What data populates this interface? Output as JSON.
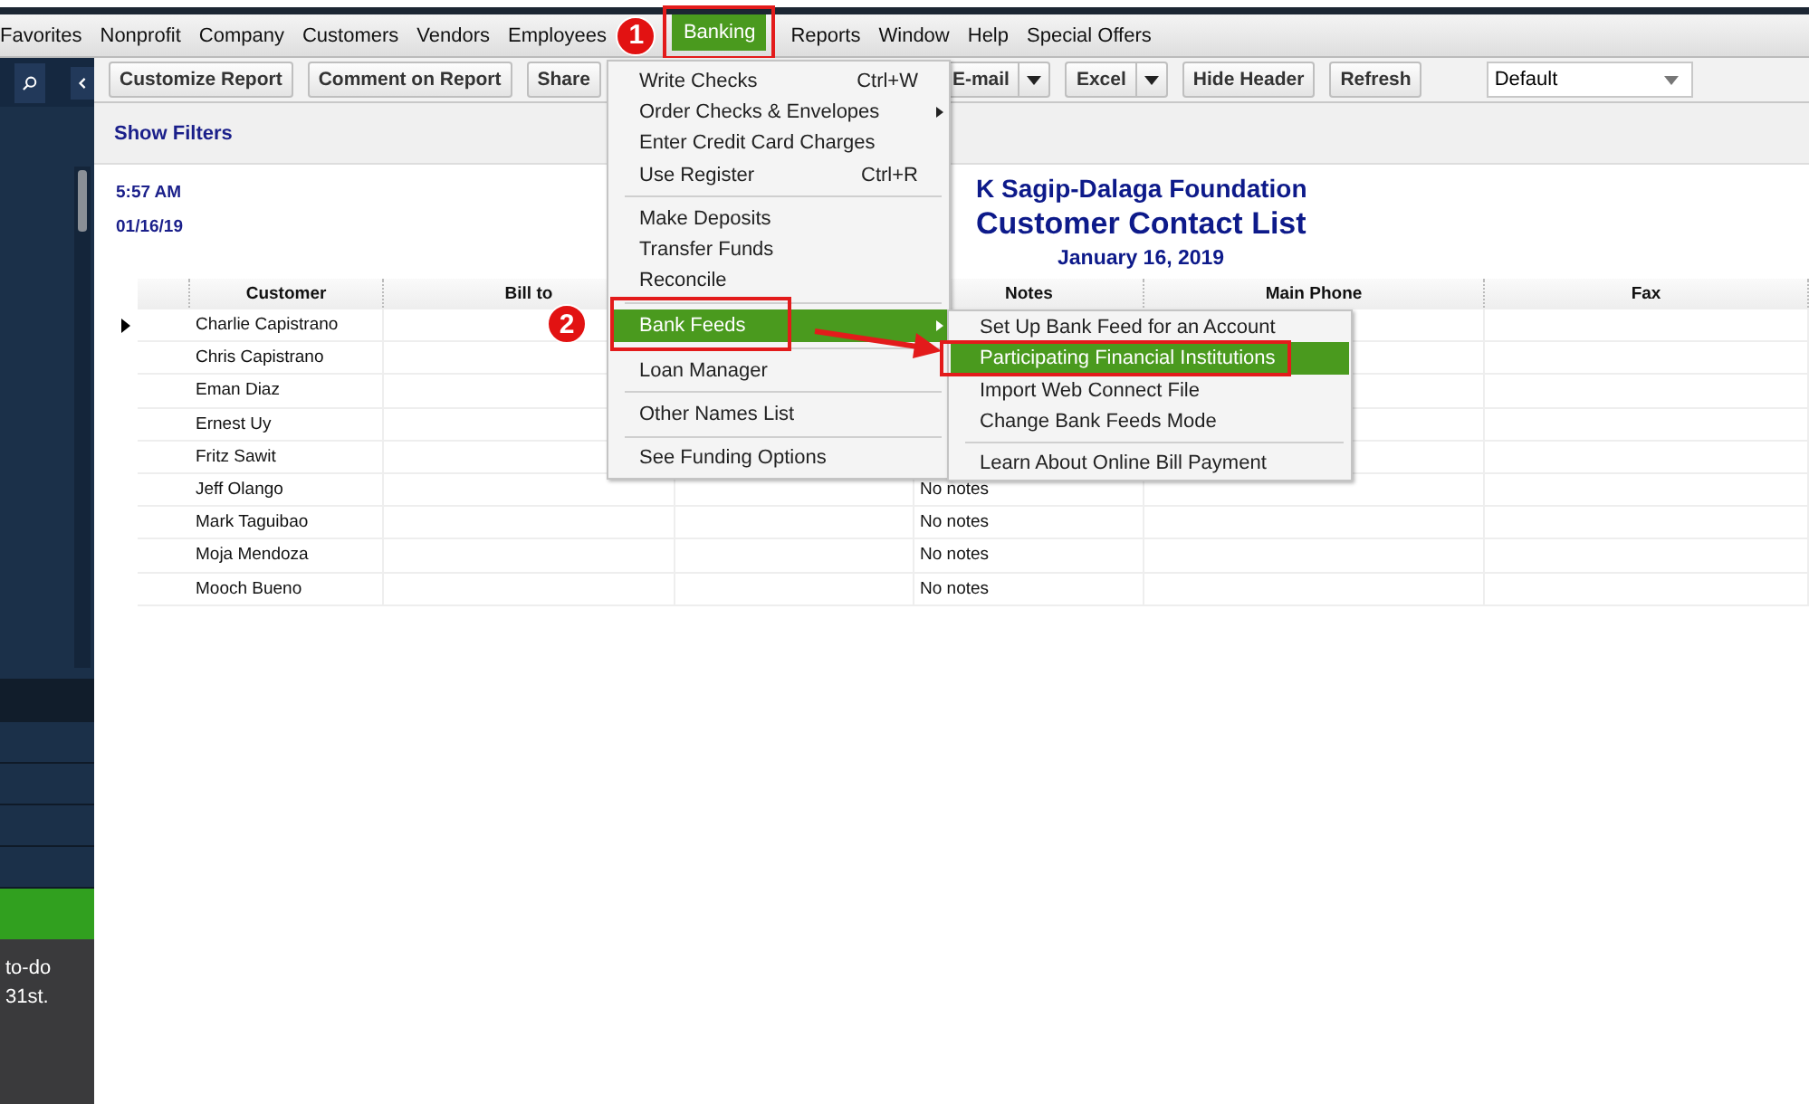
{
  "menubar": {
    "items": [
      {
        "label": "Favorites",
        "selected": false
      },
      {
        "label": "Nonprofit",
        "selected": false
      },
      {
        "label": "Company",
        "selected": false
      },
      {
        "label": "Customers",
        "selected": false
      },
      {
        "label": "Vendors",
        "selected": false
      },
      {
        "label": "Employees",
        "selected": false
      },
      {
        "label": "Banking",
        "selected": true
      },
      {
        "label": "Reports",
        "selected": false
      },
      {
        "label": "Window",
        "selected": false
      },
      {
        "label": "Help",
        "selected": false
      },
      {
        "label": "Special Offers",
        "selected": false
      }
    ]
  },
  "toolbar": {
    "buttons": [
      {
        "label": "Customize Report",
        "kind": "button"
      },
      {
        "label": "Comment on Report",
        "kind": "button"
      },
      {
        "label": "Share",
        "kind": "button"
      },
      {
        "label": "E-mail",
        "kind": "split"
      },
      {
        "label": "Excel",
        "kind": "split"
      },
      {
        "label": "Hide Header",
        "kind": "button"
      },
      {
        "label": "Refresh",
        "kind": "button"
      }
    ],
    "preset": {
      "value": "Default"
    }
  },
  "filters_link": "Show Filters",
  "report": {
    "time": "5:57 AM",
    "date": "01/16/19",
    "company": "K Sagip-Dalaga Foundation",
    "title": "Customer Contact List",
    "period": "January 16, 2019",
    "columns": [
      "Customer",
      "Bill to",
      null,
      "Notes",
      "Main Phone",
      "Fax"
    ],
    "rows": [
      {
        "customer": "Charlie Capistrano",
        "current": true
      },
      {
        "customer": "Chris Capistrano",
        "current": false
      },
      {
        "customer": "Eman Diaz",
        "current": false
      },
      {
        "customer": "Ernest Uy",
        "current": false
      },
      {
        "customer": "Fritz Sawit",
        "current": false
      },
      {
        "customer": "Jeff Olango",
        "notes": "No notes",
        "current": false
      },
      {
        "customer": "Mark Taguibao",
        "notes": "No notes",
        "current": false
      },
      {
        "customer": "Moja Mendoza",
        "notes": "No notes",
        "current": false
      },
      {
        "customer": "Mooch Bueno",
        "notes": "No notes",
        "current": false
      }
    ]
  },
  "banking_menu": {
    "groups": [
      [
        {
          "label": "Write Checks",
          "shortcut": "Ctrl+W",
          "submenu": false,
          "selected": false
        },
        {
          "label": "Order Checks & Envelopes",
          "submenu": true,
          "selected": false
        },
        {
          "label": "Enter Credit Card Charges",
          "submenu": false,
          "selected": false
        },
        {
          "label": "Use Register",
          "shortcut": "Ctrl+R",
          "submenu": false,
          "selected": false
        }
      ],
      [
        {
          "label": "Make Deposits",
          "submenu": false,
          "selected": false
        },
        {
          "label": "Transfer Funds",
          "submenu": false,
          "selected": false
        },
        {
          "label": "Reconcile",
          "submenu": false,
          "selected": false
        }
      ],
      [
        {
          "label": "Bank Feeds",
          "submenu": true,
          "selected": true
        }
      ],
      [
        {
          "label": "Loan Manager",
          "submenu": false,
          "selected": false
        }
      ],
      [
        {
          "label": "Other Names List",
          "submenu": false,
          "selected": false
        }
      ],
      [
        {
          "label": "See Funding Options",
          "submenu": false,
          "selected": false
        }
      ]
    ]
  },
  "bank_feeds_menu": {
    "groups": [
      [
        {
          "label": "Set Up Bank Feed for an Account",
          "selected": false
        },
        {
          "label": "Participating Financial Institutions",
          "selected": true
        },
        {
          "label": "Import Web Connect File",
          "selected": false
        },
        {
          "label": "Change Bank Feeds Mode",
          "selected": false
        }
      ],
      [
        {
          "label": "Learn About Online Bill Payment",
          "selected": false
        }
      ]
    ]
  },
  "step_badges": [
    "1",
    "2"
  ],
  "sidebar": {
    "note_lines": [
      "to-do",
      "31st."
    ]
  }
}
